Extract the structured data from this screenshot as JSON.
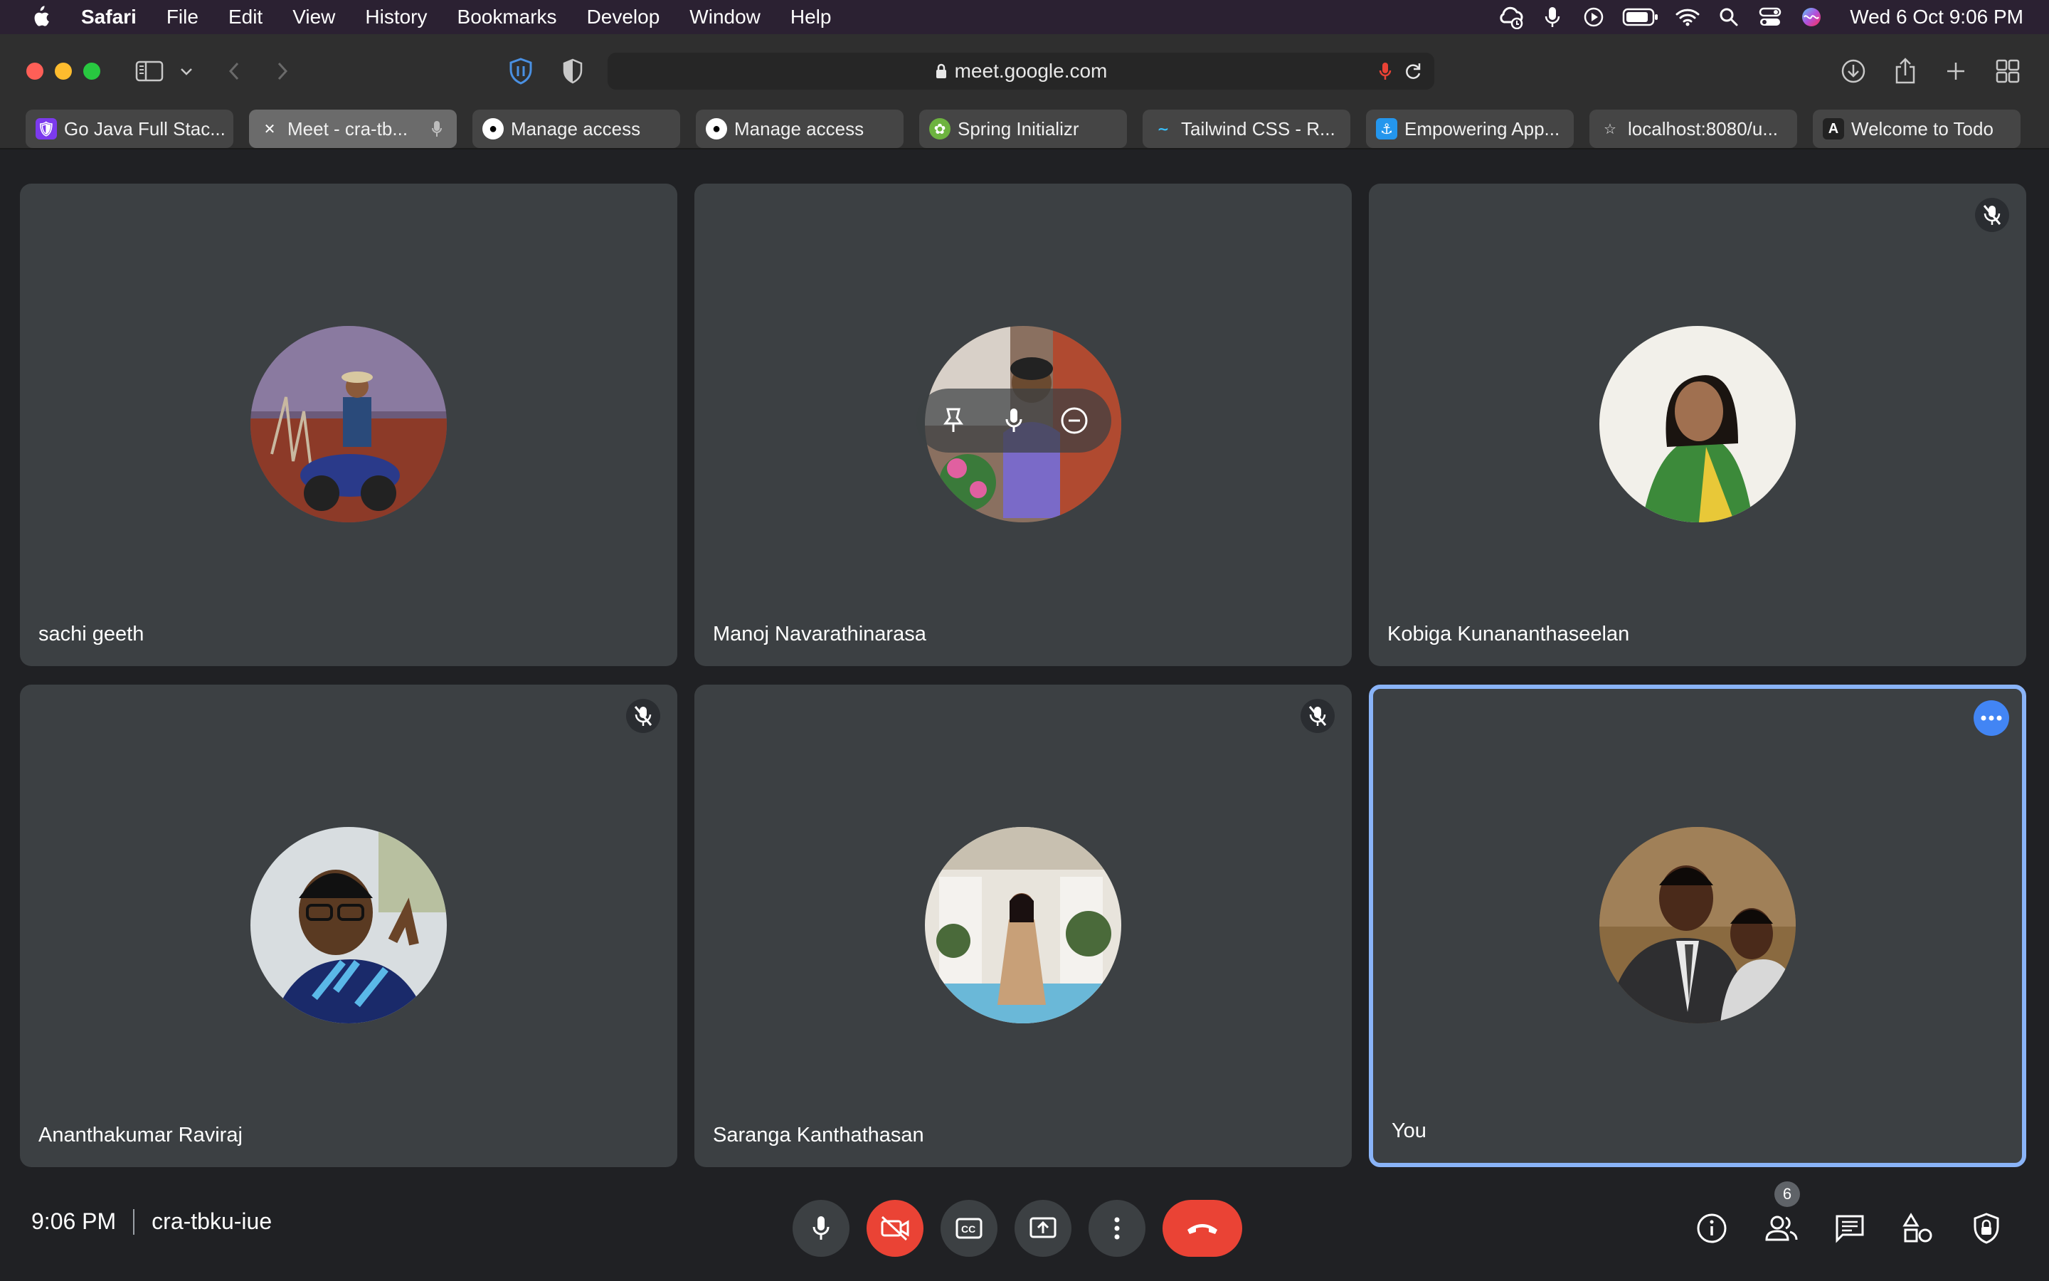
{
  "menubar": {
    "app_name": "Safari",
    "menus": [
      "File",
      "Edit",
      "View",
      "History",
      "Bookmarks",
      "Develop",
      "Window",
      "Help"
    ],
    "status_icons": [
      "cloud-sync-icon",
      "microphone-icon",
      "play-icon",
      "battery-icon",
      "wifi-icon",
      "spotlight-search-icon",
      "control-center-icon",
      "siri-icon"
    ],
    "clock": "Wed 6 Oct  9:06 PM"
  },
  "browser": {
    "url": "meet.google.com",
    "tabs": [
      {
        "label": "Go Java Full Stac...",
        "icon": "purple-shield-favicon",
        "active": false
      },
      {
        "label": "Meet - cra-tb...",
        "icon": "meet-close-favicon",
        "active": true
      },
      {
        "label": "Manage access",
        "icon": "github-favicon",
        "active": false
      },
      {
        "label": "Manage access",
        "icon": "github-favicon",
        "active": false
      },
      {
        "label": "Spring Initializr",
        "icon": "spring-favicon",
        "active": false
      },
      {
        "label": "Tailwind CSS - R...",
        "icon": "tailwind-favicon",
        "active": false
      },
      {
        "label": "Empowering App...",
        "icon": "docker-favicon",
        "active": false
      },
      {
        "label": "localhost:8080/u...",
        "icon": "star-favicon",
        "active": false
      },
      {
        "label": "Welcome to Todo",
        "icon": "angular-favicon",
        "active": false
      }
    ]
  },
  "participants": [
    {
      "name": "sachi geeth",
      "muted": false
    },
    {
      "name": "Manoj Navarathinarasa",
      "muted": false
    },
    {
      "name": "Kobiga Kunananthaseelan",
      "muted": true
    },
    {
      "name": "Ananthakumar Raviraj",
      "muted": true
    },
    {
      "name": "Saranga Kanthathasan",
      "muted": true
    },
    {
      "name": "You",
      "muted": false
    }
  ],
  "meeting": {
    "time": "9:06 PM",
    "code": "cra-tbku-iue",
    "participant_count": "6"
  },
  "colors": {
    "accent_blue": "#8ab4f8",
    "end_call_red": "#ea4335",
    "tile_bg": "#3c4043",
    "page_bg": "#202124"
  }
}
